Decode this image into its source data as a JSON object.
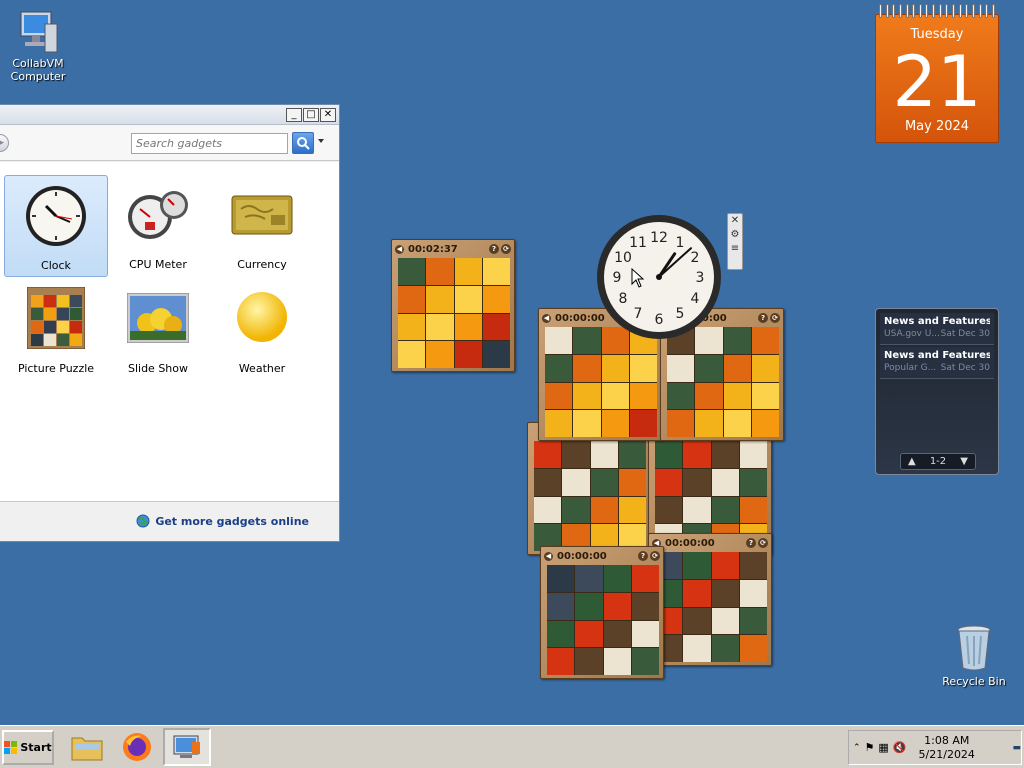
{
  "desktop_icons": {
    "computer": "CollabVM Computer",
    "recycle_bin": "Recycle Bin"
  },
  "gallery": {
    "search_placeholder": "Search gadgets",
    "items": [
      {
        "label": "Clock",
        "icon": "clock-icon",
        "selected": true
      },
      {
        "label": "CPU Meter",
        "icon": "cpu-meter-icon"
      },
      {
        "label": "Currency",
        "icon": "currency-icon"
      },
      {
        "label": "Picture Puzzle",
        "icon": "picture-puzzle-icon"
      },
      {
        "label": "Slide Show",
        "icon": "slide-show-icon"
      },
      {
        "label": "Weather",
        "icon": "weather-icon"
      }
    ],
    "more_link": "Get more gadgets online",
    "window_buttons": [
      "minimize",
      "maximize",
      "close"
    ]
  },
  "calendar": {
    "day": "Tuesday",
    "date": "21",
    "month_year": "May 2024"
  },
  "clock_gadget": {
    "hour": 1,
    "minute": 8
  },
  "puzzles": [
    {
      "timer": "00:02:37"
    },
    {
      "timer": "00:00:00"
    },
    {
      "timer": "00:00:00"
    },
    {
      "timer": "00:00:00"
    },
    {
      "timer": "00:00:00"
    }
  ],
  "feed": {
    "items": [
      {
        "title": "News and Features f...",
        "source": "USA.gov U...",
        "date": "Sat Dec 30"
      },
      {
        "title": "News and Features f...",
        "source": "Popular G...",
        "date": "Sat Dec 30"
      }
    ],
    "page": "1-2"
  },
  "taskbar": {
    "start": "Start",
    "time": "1:08 AM",
    "date": "5/21/2024"
  },
  "colors": {
    "desktop": "#3a6ea5",
    "calendar": "#e8650f"
  }
}
